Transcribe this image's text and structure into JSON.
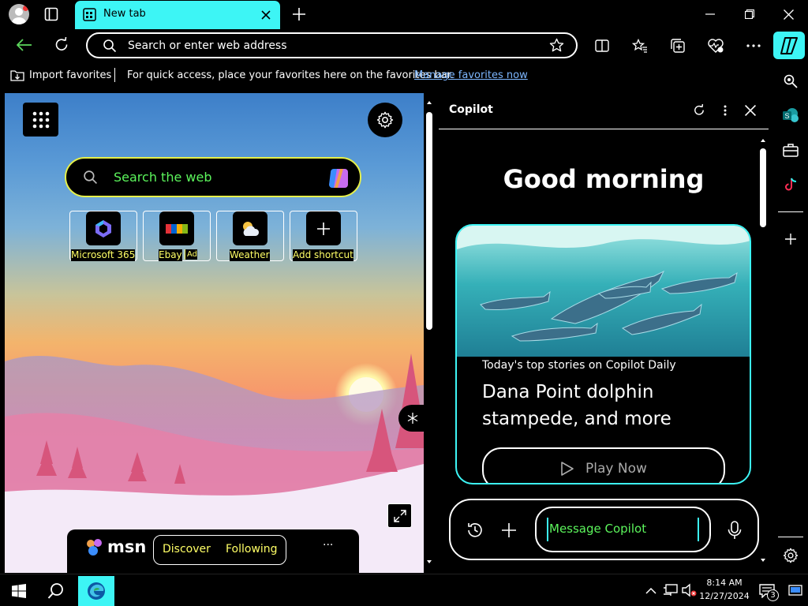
{
  "browser": {
    "tab_title": "New tab",
    "address_placeholder": "Search or enter web address"
  },
  "favorites_bar": {
    "import_label": "Import favorites",
    "hint_text": "For quick access, place your favorites here on the favorites bar.",
    "manage_link": "Manage favorites now"
  },
  "new_tab": {
    "search_placeholder": "Search the web",
    "shortcuts": [
      {
        "label": "Microsoft 365",
        "icon": "microsoft-365-icon"
      },
      {
        "label": "Ebay",
        "badge": "Ad",
        "icon": "ebay-icon"
      },
      {
        "label": "Weather",
        "icon": "weather-icon"
      },
      {
        "label": "Add shortcut",
        "icon": "plus-icon"
      }
    ],
    "feed": {
      "brand": "msn",
      "tab_discover": "Discover",
      "tab_following": "Following",
      "more": "···"
    }
  },
  "copilot": {
    "title": "Copilot",
    "greeting": "Good morning",
    "card": {
      "kicker": "Today's top stories on Copilot Daily",
      "headline": "Dana Point dolphin stampede, and more",
      "play_label": "Play Now"
    },
    "composer_placeholder": "Message Copilot"
  },
  "taskbar": {
    "time": "8:14 AM",
    "date": "12/27/2024",
    "notification_count": "3"
  },
  "colors": {
    "accent_cyan": "#3df5f5",
    "link_blue": "#7db7ff",
    "highlight_yellow": "#ffff66",
    "search_green": "#5cf55c"
  }
}
